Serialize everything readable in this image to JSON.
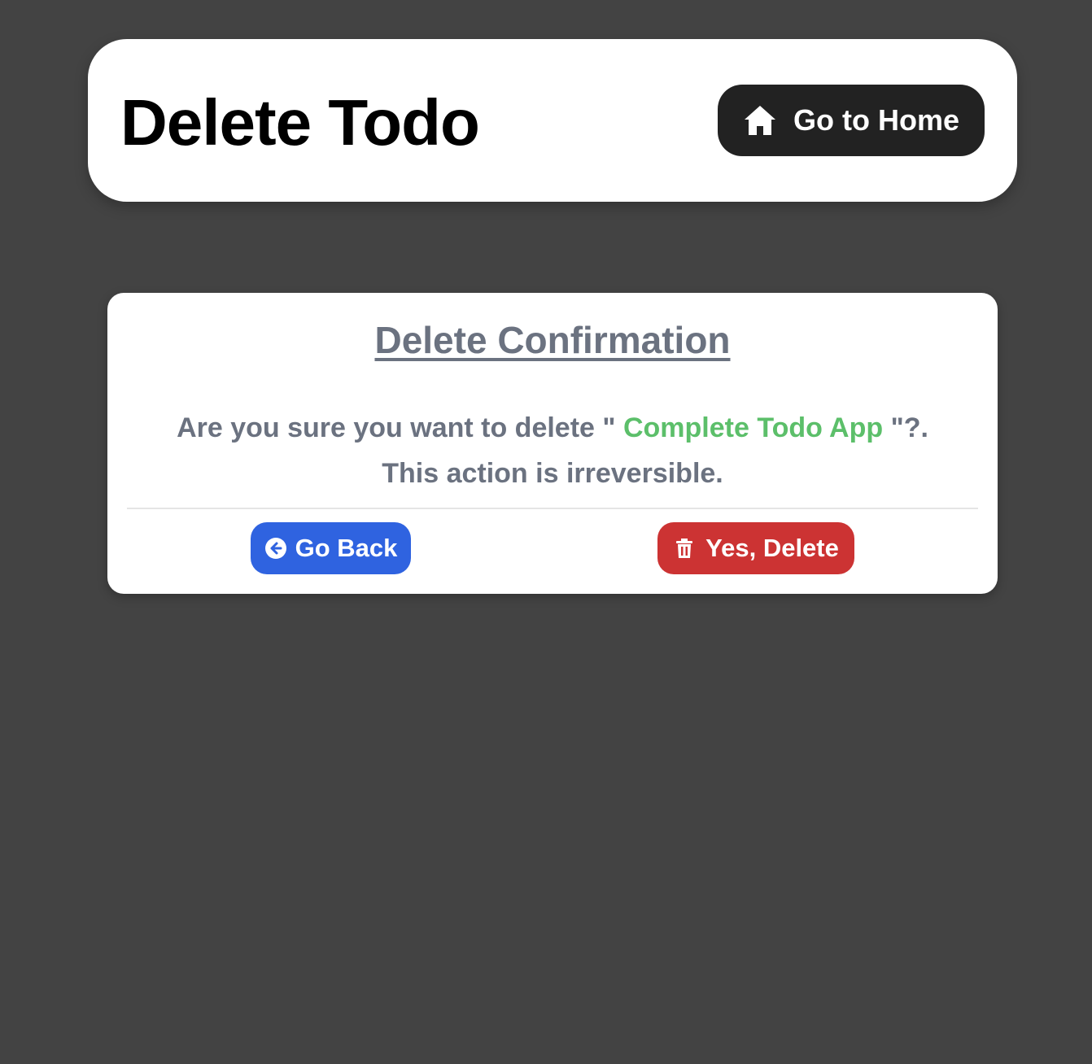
{
  "header": {
    "title": "Delete Todo",
    "home_button_label": "Go to Home",
    "home_icon": "home-icon"
  },
  "confirmation": {
    "title": "Delete Confirmation",
    "message_prefix": "Are you sure you want to delete \" ",
    "todo_name": "Complete Todo App",
    "message_suffix": " \"?.",
    "message_line2": "This action is irreversible.",
    "back_button_label": "Go Back",
    "back_icon": "arrow-left-circle-icon",
    "delete_button_label": "Yes, Delete",
    "delete_icon": "trash-icon"
  },
  "colors": {
    "background": "#434343",
    "home_button": "#222222",
    "back_button": "#2f63e0",
    "delete_button": "#cc3333",
    "todo_name": "#5cbf6a",
    "muted_text": "#6b7280"
  }
}
